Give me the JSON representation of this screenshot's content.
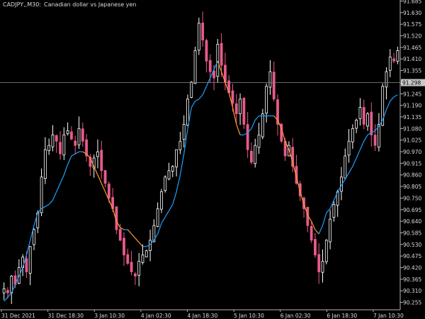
{
  "header": {
    "symbol_timeframe": "CADJPY,,M30:",
    "description": "Canadian dollar vs Japanese yen"
  },
  "colors": {
    "background": "#000000",
    "axis": "#b4b4b4",
    "text": "#dcdcdc",
    "candle_up": "#ffffff",
    "candle_down": "#e85a8a",
    "line_up": "#1ea0ff",
    "line_down": "#ff9a2e",
    "current_price_line": "#8a8a8a",
    "price_tag": "#c8c8c8"
  },
  "chart_data": {
    "type": "line",
    "series": [],
    "y_ticks": [
      "91.685",
      "91.630",
      "91.575",
      "91.520",
      "91.465",
      "91.410",
      "91.355",
      "91.295",
      "91.245",
      "91.190",
      "91.135",
      "91.080",
      "91.025",
      "90.970",
      "90.915",
      "90.860",
      "90.805",
      "90.750",
      "90.695",
      "90.640",
      "90.585",
      "90.530",
      "90.475",
      "90.420",
      "90.365",
      "90.310",
      "90.255"
    ],
    "ylim": [
      90.22,
      91.69
    ],
    "x_ticks": [
      "31 Dec 2021",
      "31 Dec 18:30",
      "3 Jan 10:30",
      "4 Jan 02:30",
      "4 Jan 18:30",
      "5 Jan 10:30",
      "6 Jan 02:30",
      "6 Jan 18:30",
      "7 Jan 10:30"
    ],
    "current_price": "91.298",
    "close": [
      90.32,
      90.3,
      90.38,
      90.34,
      90.42,
      90.47,
      90.4,
      90.52,
      90.6,
      90.68,
      90.85,
      90.98,
      91.0,
      91.05,
      91.02,
      90.96,
      91.05,
      91.07,
      91.03,
      91.0,
      91.08,
      91.02,
      90.95,
      90.9,
      90.94,
      90.97,
      90.88,
      90.82,
      90.75,
      90.7,
      90.6,
      90.55,
      90.48,
      90.44,
      90.4,
      90.38,
      90.45,
      90.48,
      90.5,
      90.55,
      90.62,
      90.7,
      90.78,
      90.85,
      90.88,
      90.9,
      90.98,
      91.02,
      91.1,
      91.22,
      91.3,
      91.45,
      91.58,
      91.5,
      91.4,
      91.35,
      91.32,
      91.48,
      91.38,
      91.3,
      91.25,
      91.2,
      91.15,
      91.22,
      91.1,
      90.98,
      90.92,
      91.0,
      91.05,
      91.15,
      91.28,
      91.35,
      91.22,
      91.1,
      91.02,
      90.95,
      91.0,
      90.9,
      90.82,
      90.76,
      90.7,
      90.62,
      90.55,
      90.48,
      90.4,
      90.45,
      90.55,
      90.65,
      90.72,
      90.78,
      90.85,
      90.95,
      91.02,
      91.08,
      91.12,
      91.18,
      91.1,
      91.15,
      91.05,
      91.0,
      91.1,
      91.28,
      91.35,
      91.42,
      91.4,
      91.45
    ],
    "indicator": [
      90.26,
      90.28,
      90.3,
      90.34,
      90.38,
      90.42,
      90.48,
      90.55,
      90.62,
      90.68,
      90.7,
      90.71,
      90.72,
      90.74,
      90.78,
      90.82,
      90.86,
      90.91,
      90.95,
      90.96,
      90.97,
      90.97,
      90.96,
      90.94,
      90.9,
      90.86,
      90.82,
      90.78,
      90.74,
      90.7,
      90.64,
      90.61,
      90.6,
      90.6,
      90.58,
      90.56,
      90.54,
      90.52,
      90.52,
      90.53,
      90.55,
      90.58,
      90.63,
      90.66,
      90.69,
      90.72,
      90.78,
      90.86,
      90.96,
      91.08,
      91.18,
      91.21,
      91.22,
      91.24,
      91.28,
      91.32,
      91.36,
      91.4,
      91.35,
      91.3,
      91.25,
      91.18,
      91.1,
      91.05,
      91.05,
      91.06,
      91.08,
      91.12,
      91.14,
      91.14,
      91.14,
      91.14,
      91.14,
      91.12,
      91.08,
      91.02,
      90.98,
      90.92,
      90.85,
      90.78,
      90.72,
      90.67,
      90.64,
      90.6,
      90.58,
      90.62,
      90.68,
      90.7,
      90.74,
      90.78,
      90.81,
      90.84,
      90.87,
      90.9,
      90.94,
      90.98,
      91.02,
      91.05,
      91.06,
      91.07,
      91.09,
      91.12,
      91.17,
      91.21,
      91.23,
      91.24
    ]
  }
}
